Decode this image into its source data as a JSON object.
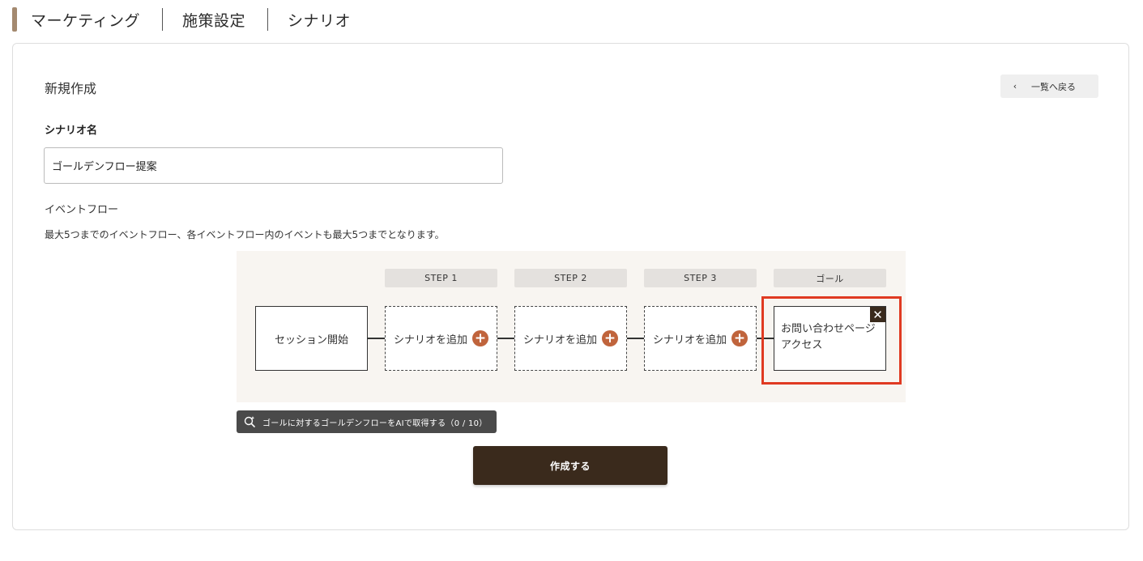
{
  "breadcrumb": {
    "items": [
      {
        "label": "マーケティング"
      },
      {
        "label": "施策設定"
      },
      {
        "label": "シナリオ"
      }
    ]
  },
  "page": {
    "title": "新規作成",
    "back_label": "一覧へ戻る"
  },
  "form": {
    "scenario_name_label": "シナリオ名",
    "scenario_name_value": "ゴールデンフロー提案",
    "event_flow_label": "イベントフロー",
    "event_flow_description": "最大5つまでのイベントフロー、各イベントフロー内のイベントも最大5つまでとなります。"
  },
  "flow": {
    "headers": [
      "STEP 1",
      "STEP 2",
      "STEP 3",
      "ゴール"
    ],
    "start_node": "セッション開始",
    "add_label": "シナリオを追加",
    "plus_glyph": "+",
    "goal_line1": "お問い合わせページ",
    "goal_line2": "アクセス",
    "close_glyph": "✕"
  },
  "ai_button": {
    "label": "ゴールに対するゴールデンフローをAIで取得する（0 / 10）",
    "icon": "magic-search-icon"
  },
  "actions": {
    "create_label": "作成する"
  },
  "colors": {
    "accent_brown": "#3a2a1c",
    "plus_orange": "#c0643c",
    "highlight_red": "#e03a22",
    "breadcrumb_accent": "#a4896f"
  }
}
